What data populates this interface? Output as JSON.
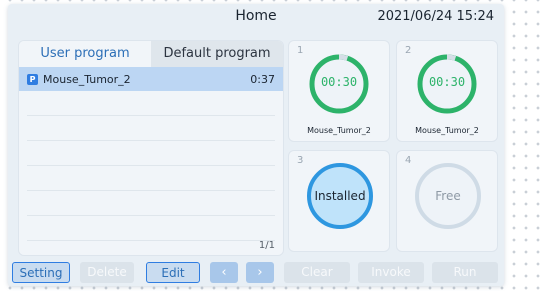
{
  "header": {
    "title": "Home",
    "datetime": "2021/06/24 15:24"
  },
  "program_panel": {
    "tabs": [
      {
        "label": "User program",
        "active": true
      },
      {
        "label": "Default program",
        "active": false
      }
    ],
    "programs": [
      {
        "badge": "P",
        "name": "Mouse_Tumor_2",
        "time": "0:37",
        "selected": true
      }
    ],
    "page": "1/1"
  },
  "wells": [
    {
      "number": "1",
      "status": "running",
      "timer": "00:30",
      "program": "Mouse_Tumor_2",
      "progress": 0.05
    },
    {
      "number": "2",
      "status": "running",
      "timer": "00:30",
      "program": "Mouse_Tumor_2",
      "progress": 0.05
    },
    {
      "number": "3",
      "status": "installed",
      "label": "Installed"
    },
    {
      "number": "4",
      "status": "free",
      "label": "Free"
    }
  ],
  "toolbar": {
    "setting": "Setting",
    "delete": "Delete",
    "edit": "Edit",
    "prev": "‹",
    "next": "›",
    "clear": "Clear",
    "invoke": "Invoke",
    "run": "Run"
  },
  "colors": {
    "accent": "#2f7de1",
    "timer_green": "#2db36a",
    "installed_blue": "#2e97e0"
  }
}
